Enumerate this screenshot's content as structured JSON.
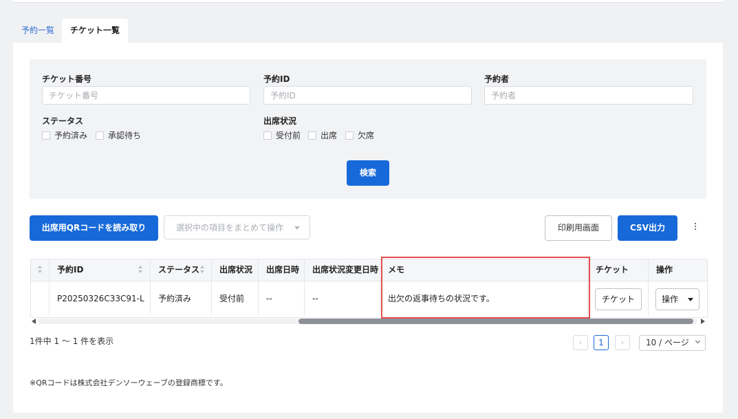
{
  "tabs": [
    {
      "label": "予約一覧",
      "active": false
    },
    {
      "label": "チケット一覧",
      "active": true
    }
  ],
  "filters": {
    "ticket_number": {
      "label": "チケット番号",
      "placeholder": "チケット番号",
      "value": ""
    },
    "reservation_id": {
      "label": "予約ID",
      "placeholder": "予約ID",
      "value": ""
    },
    "reserver": {
      "label": "予約者",
      "placeholder": "予約者",
      "value": ""
    },
    "status": {
      "label": "ステータス",
      "options": [
        "予約済み",
        "承認待ち"
      ]
    },
    "attendance": {
      "label": "出席状況",
      "options": [
        "受付前",
        "出席",
        "欠席"
      ]
    },
    "search_button": "検索"
  },
  "actions": {
    "scan_qr": "出席用QRコードを読み取り",
    "bulk_action_placeholder": "選択中の項目をまとめて操作",
    "print_view": "印刷用画面",
    "csv_export": "CSV出力"
  },
  "table": {
    "columns": [
      "予約ID",
      "ステータス",
      "出席状況",
      "出席日時",
      "出席状況変更日時",
      "メモ",
      "チケット",
      "操作"
    ],
    "rows": [
      {
        "reservation_id": "P20250326C33C91-L",
        "status": "予約済み",
        "attendance": "受付前",
        "attended_at": "--",
        "attendance_changed_at": "--",
        "memo": "出欠の返事待ちの状況です。",
        "ticket_button": "チケット",
        "action_button": "操作"
      }
    ]
  },
  "pagination": {
    "summary": "1件中 1 〜 1 件を表示",
    "current_page": "1",
    "prev": "‹",
    "next": "›",
    "page_size": "10 / ページ"
  },
  "footnote": "※QRコードは株式会社デンソーウェーブの登録商標です。",
  "colors": {
    "primary": "#1769d9",
    "highlight": "#e44c4c",
    "background": "#f0f1f3"
  }
}
